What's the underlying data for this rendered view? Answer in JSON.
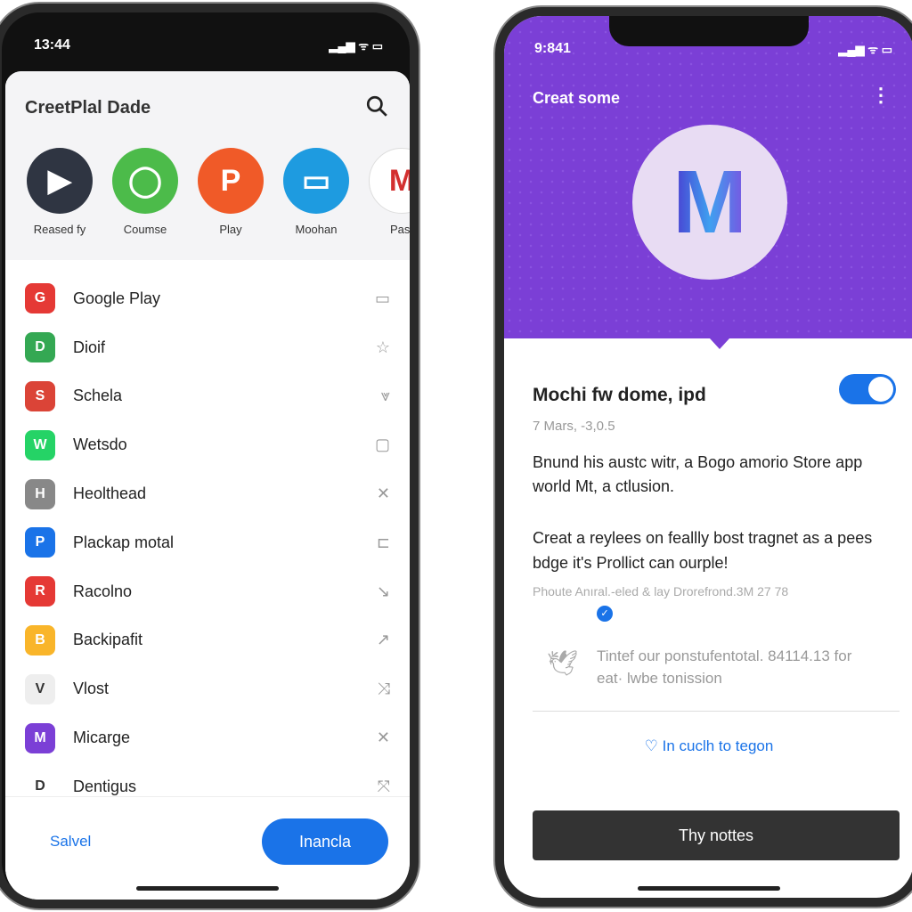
{
  "left_phone": {
    "status": {
      "time": "13:44"
    },
    "sheet_title": "CreetPlal Dade",
    "apps": [
      {
        "label": "Reased fy",
        "icon": "play-store-icon",
        "color": "#2f3542"
      },
      {
        "label": "Coumse",
        "icon": "chat-bubble-icon",
        "color": "#4cbb4a"
      },
      {
        "label": "Play",
        "icon": "pinterest-icon",
        "color": "#f05a28"
      },
      {
        "label": "Moohan",
        "icon": "screen-icon",
        "color": "#1e9be0"
      },
      {
        "label": "Past",
        "icon": "m-logo-icon",
        "color": "#ffffff"
      }
    ],
    "items": [
      {
        "label": "Google Play",
        "color": "#e53935",
        "trail": "▭"
      },
      {
        "label": "Dioif",
        "color": "#34a853",
        "trail": "☆"
      },
      {
        "label": "Schela",
        "color": "#db4437",
        "trail": "⩔"
      },
      {
        "label": "Wetsdo",
        "color": "#25d366",
        "trail": "▢"
      },
      {
        "label": "Heolthead",
        "color": "#888888",
        "trail": "✕"
      },
      {
        "label": "Plackap motal",
        "color": "#1a73e8",
        "trail": "⊏"
      },
      {
        "label": "Racolno",
        "color": "#e53935",
        "trail": "↘"
      },
      {
        "label": "Backipafit",
        "color": "#f9b52a",
        "trail": "↗"
      },
      {
        "label": "Vlost",
        "color": "#eeeeee",
        "trail": "⤨"
      },
      {
        "label": "Micarge",
        "color": "#7b3fd6",
        "trail": "✕"
      },
      {
        "label": "Dentigus",
        "color": "#ffffff",
        "trail": "⤧"
      }
    ],
    "cancel_label": "Salvel",
    "confirm_label": "Inancla"
  },
  "right_phone": {
    "status": {
      "time": "9:841"
    },
    "header_title": "Creat some",
    "logo_letter": "M",
    "card_title": "Mochi fw dome, ipd",
    "toggle_on": true,
    "date": "7 Mars, -3,0.5",
    "para1": "Bnund his austc witr, a Bogo amorio Store app world Mt, a ctlusion.",
    "para2": "Creat a reylees on feallly bost tragnet as a pees bdge it's Prollict can ourple!",
    "meta": "Phoute Anıral.-eled & lay Drorefrond.3M 27 78",
    "tweet": "Tintef our ponstufentotal. 84114.13 for eat· lwbe tonission",
    "link": "In cuclh to tegon",
    "button": "Thy nottes",
    "accent": "#7b3fd6"
  }
}
